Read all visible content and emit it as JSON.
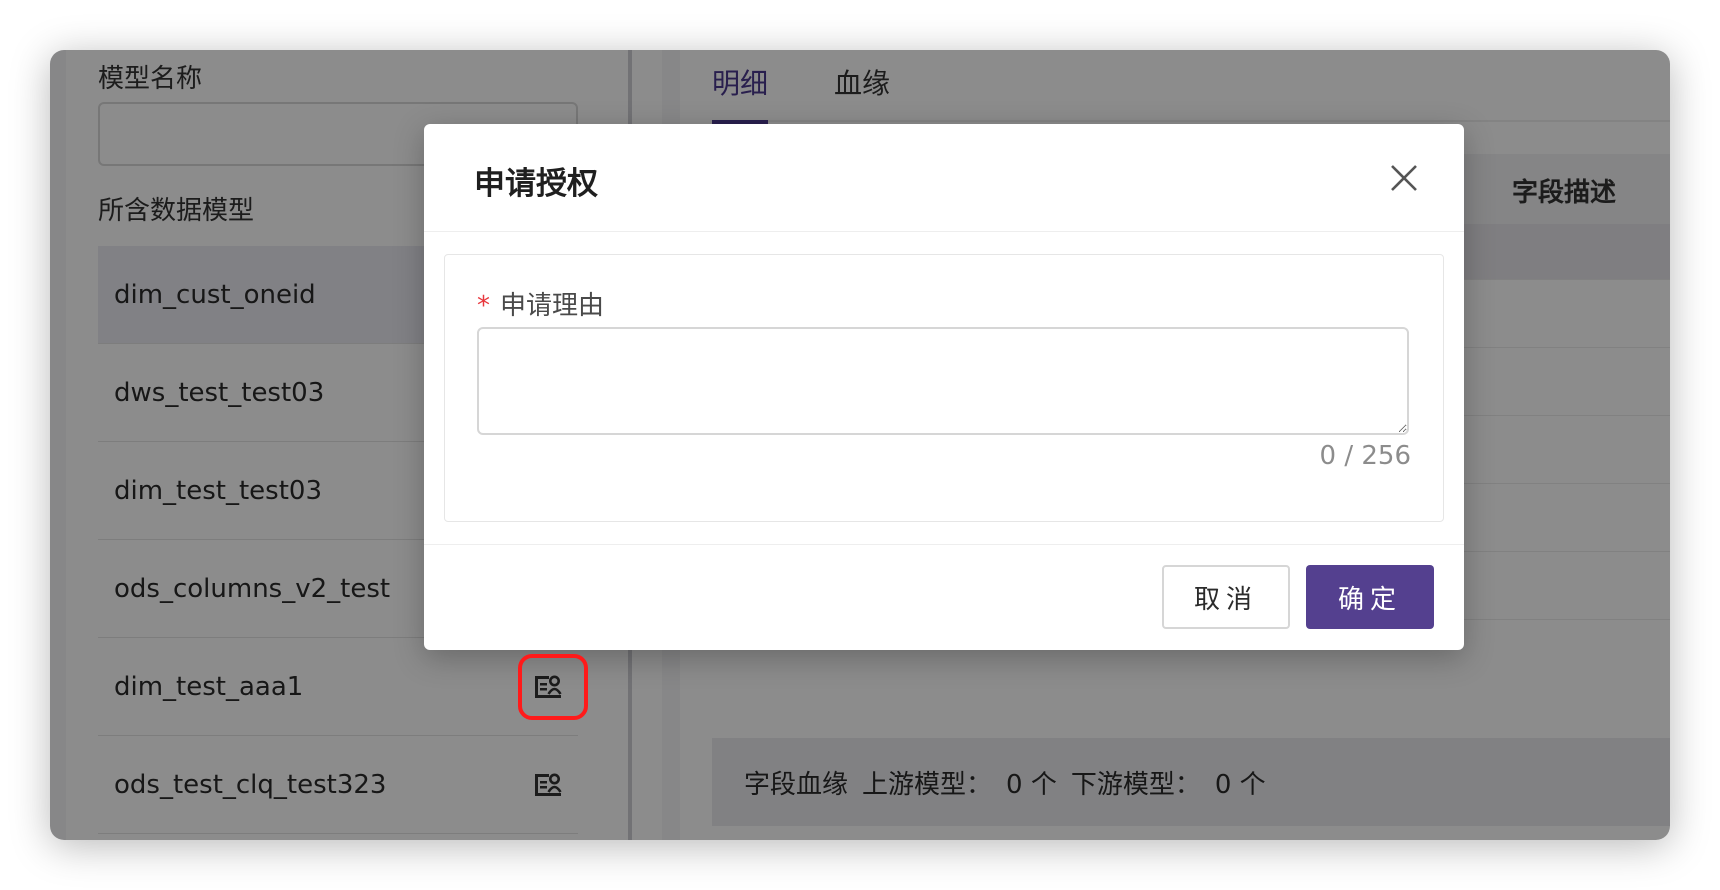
{
  "left_panel": {
    "model_name_label": "模型名称",
    "model_name_value": "",
    "data_models_label": "所含数据模型",
    "models": [
      {
        "name": "dim_cust_oneid"
      },
      {
        "name": "dws_test_test03"
      },
      {
        "name": "dim_test_test03"
      },
      {
        "name": "ods_columns_v2_test"
      },
      {
        "name": "dim_test_aaa1",
        "icon": "apply-permission-icon"
      },
      {
        "name": "ods_test_clq_test323",
        "icon": "apply-permission-icon"
      }
    ]
  },
  "right_panel": {
    "tabs": [
      {
        "label": "明细",
        "active": true
      },
      {
        "label": "血缘",
        "active": false
      }
    ],
    "table_header_visible": "字段描述",
    "lineage": {
      "title": "字段血缘",
      "upstream_label": "上游模型：",
      "upstream_value": "0 个",
      "downstream_label": "下游模型：",
      "downstream_value": "0 个"
    }
  },
  "modal": {
    "title": "申请授权",
    "reason_label": "申请理由",
    "required_mark": "*",
    "reason_value": "",
    "counter": "0 / 256",
    "cancel_label": "取消",
    "confirm_label": "确定",
    "close_icon": "close-icon"
  },
  "colors": {
    "accent": "#54408f",
    "active_tab": "#4b3a8e",
    "required": "#e8373d",
    "highlight": "#ff1a1a"
  }
}
